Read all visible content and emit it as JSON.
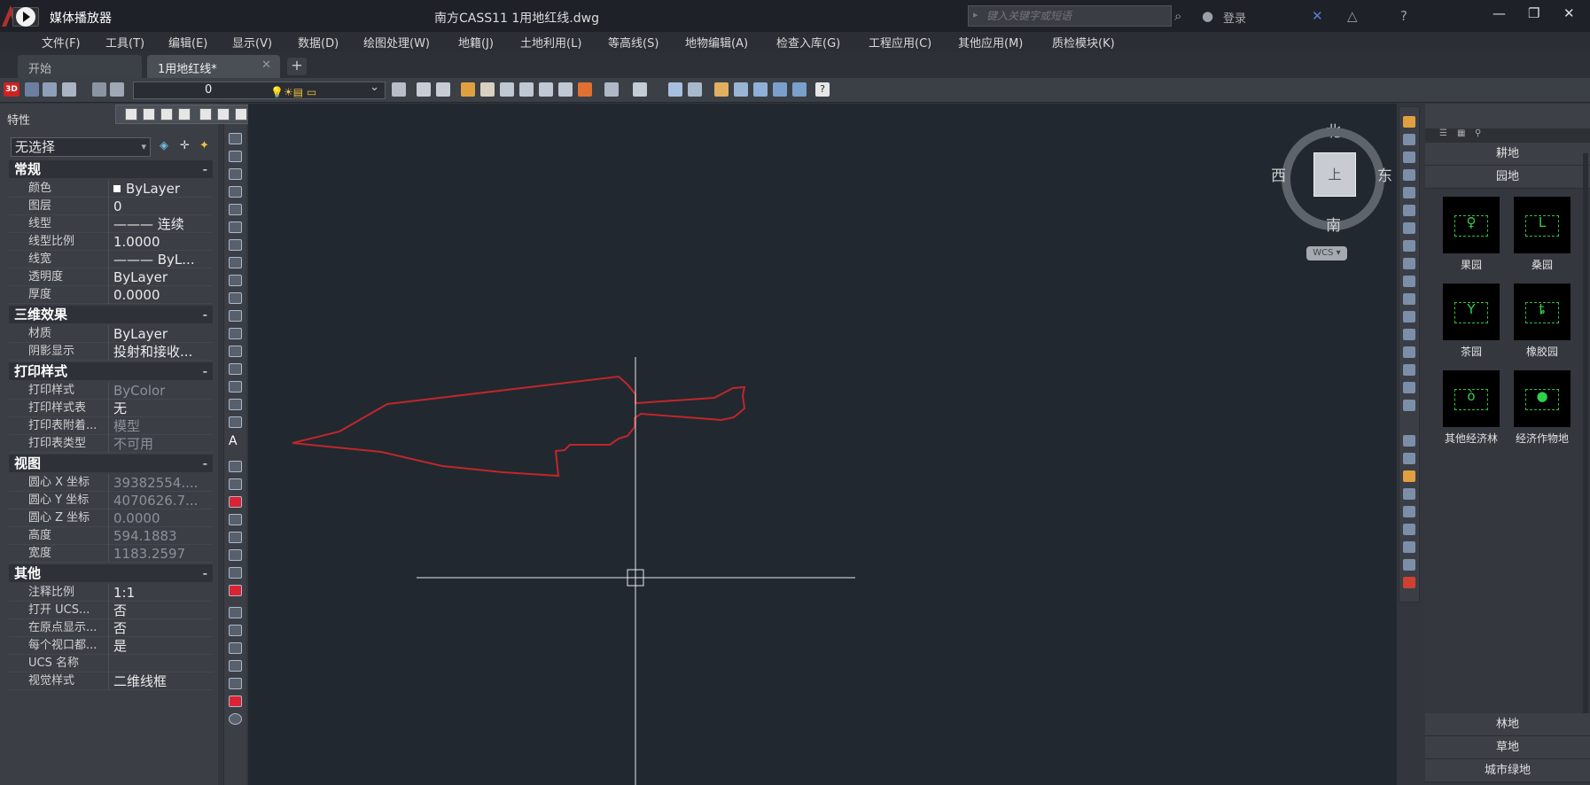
{
  "title_bar": {
    "media_player_label": "媒体播放器",
    "document_title": "南方CASS11    1用地红线.dwg",
    "search_placeholder": "键入关键字或短语",
    "login_label": "登录"
  },
  "menu": [
    "文件(F)",
    "工具(T)",
    "编辑(E)",
    "显示(V)",
    "数据(D)",
    "绘图处理(W)",
    "地籍(J)",
    "土地利用(L)",
    "等高线(S)",
    "地物编辑(A)",
    "检查入库(G)",
    "工程应用(C)",
    "其他应用(M)",
    "质检模块(K)"
  ],
  "tabs": [
    {
      "label": "开始",
      "active": false
    },
    {
      "label": "1用地红线*",
      "active": true
    }
  ],
  "toolbar": {
    "layer_value": "0",
    "badge_3d": "3D"
  },
  "properties": {
    "title": "特性",
    "selection": "无选择",
    "sections": [
      {
        "name": "常规",
        "rows": [
          {
            "k": "颜色",
            "v": "ByLayer"
          },
          {
            "k": "图层",
            "v": "0"
          },
          {
            "k": "线型",
            "v": "——— 连续"
          },
          {
            "k": "线型比例",
            "v": "1.0000"
          },
          {
            "k": "线宽",
            "v": "——— ByL..."
          },
          {
            "k": "透明度",
            "v": "ByLayer"
          },
          {
            "k": "厚度",
            "v": "0.0000"
          }
        ]
      },
      {
        "name": "三维效果",
        "rows": [
          {
            "k": "材质",
            "v": "ByLayer"
          },
          {
            "k": "阴影显示",
            "v": "投射和接收..."
          }
        ]
      },
      {
        "name": "打印样式",
        "rows": [
          {
            "k": "打印样式",
            "v": "ByColor",
            "dim": true
          },
          {
            "k": "打印样式表",
            "v": "无"
          },
          {
            "k": "打印表附着...",
            "v": "模型",
            "dim": true
          },
          {
            "k": "打印表类型",
            "v": "不可用",
            "dim": true
          }
        ]
      },
      {
        "name": "视图",
        "rows": [
          {
            "k": "圆心 X 坐标",
            "v": "39382554....",
            "dim": true
          },
          {
            "k": "圆心 Y 坐标",
            "v": "4070626.7...",
            "dim": true
          },
          {
            "k": "圆心 Z 坐标",
            "v": "0.0000",
            "dim": true
          },
          {
            "k": "高度",
            "v": "594.1883",
            "dim": true
          },
          {
            "k": "宽度",
            "v": "1183.2597",
            "dim": true
          }
        ]
      },
      {
        "name": "其他",
        "rows": [
          {
            "k": "注释比例",
            "v": "1:1"
          },
          {
            "k": "打开 UCS...",
            "v": "否"
          },
          {
            "k": "在原点显示...",
            "v": "否"
          },
          {
            "k": "每个视口都...",
            "v": "是"
          },
          {
            "k": "UCS 名称",
            "v": ""
          },
          {
            "k": "视觉样式",
            "v": "二维线框"
          }
        ]
      }
    ]
  },
  "viewcube": {
    "north": "北",
    "south": "南",
    "east": "东",
    "west": "西",
    "face": "上",
    "wcs": "WCS"
  },
  "symbols": {
    "category_top_1": "耕地",
    "category_top_2": "园地",
    "items": [
      "果园",
      "桑园",
      "茶园",
      "橡胶园",
      "其他经济林",
      "经济作物地"
    ],
    "category_bottom": [
      "林地",
      "草地",
      "城市绿地"
    ]
  },
  "colors": {
    "canvas_bg": "#212830",
    "boundary_red": "#c0262a",
    "crosshair": "#e8e8e8",
    "symbol_green": "#2fd04a"
  }
}
